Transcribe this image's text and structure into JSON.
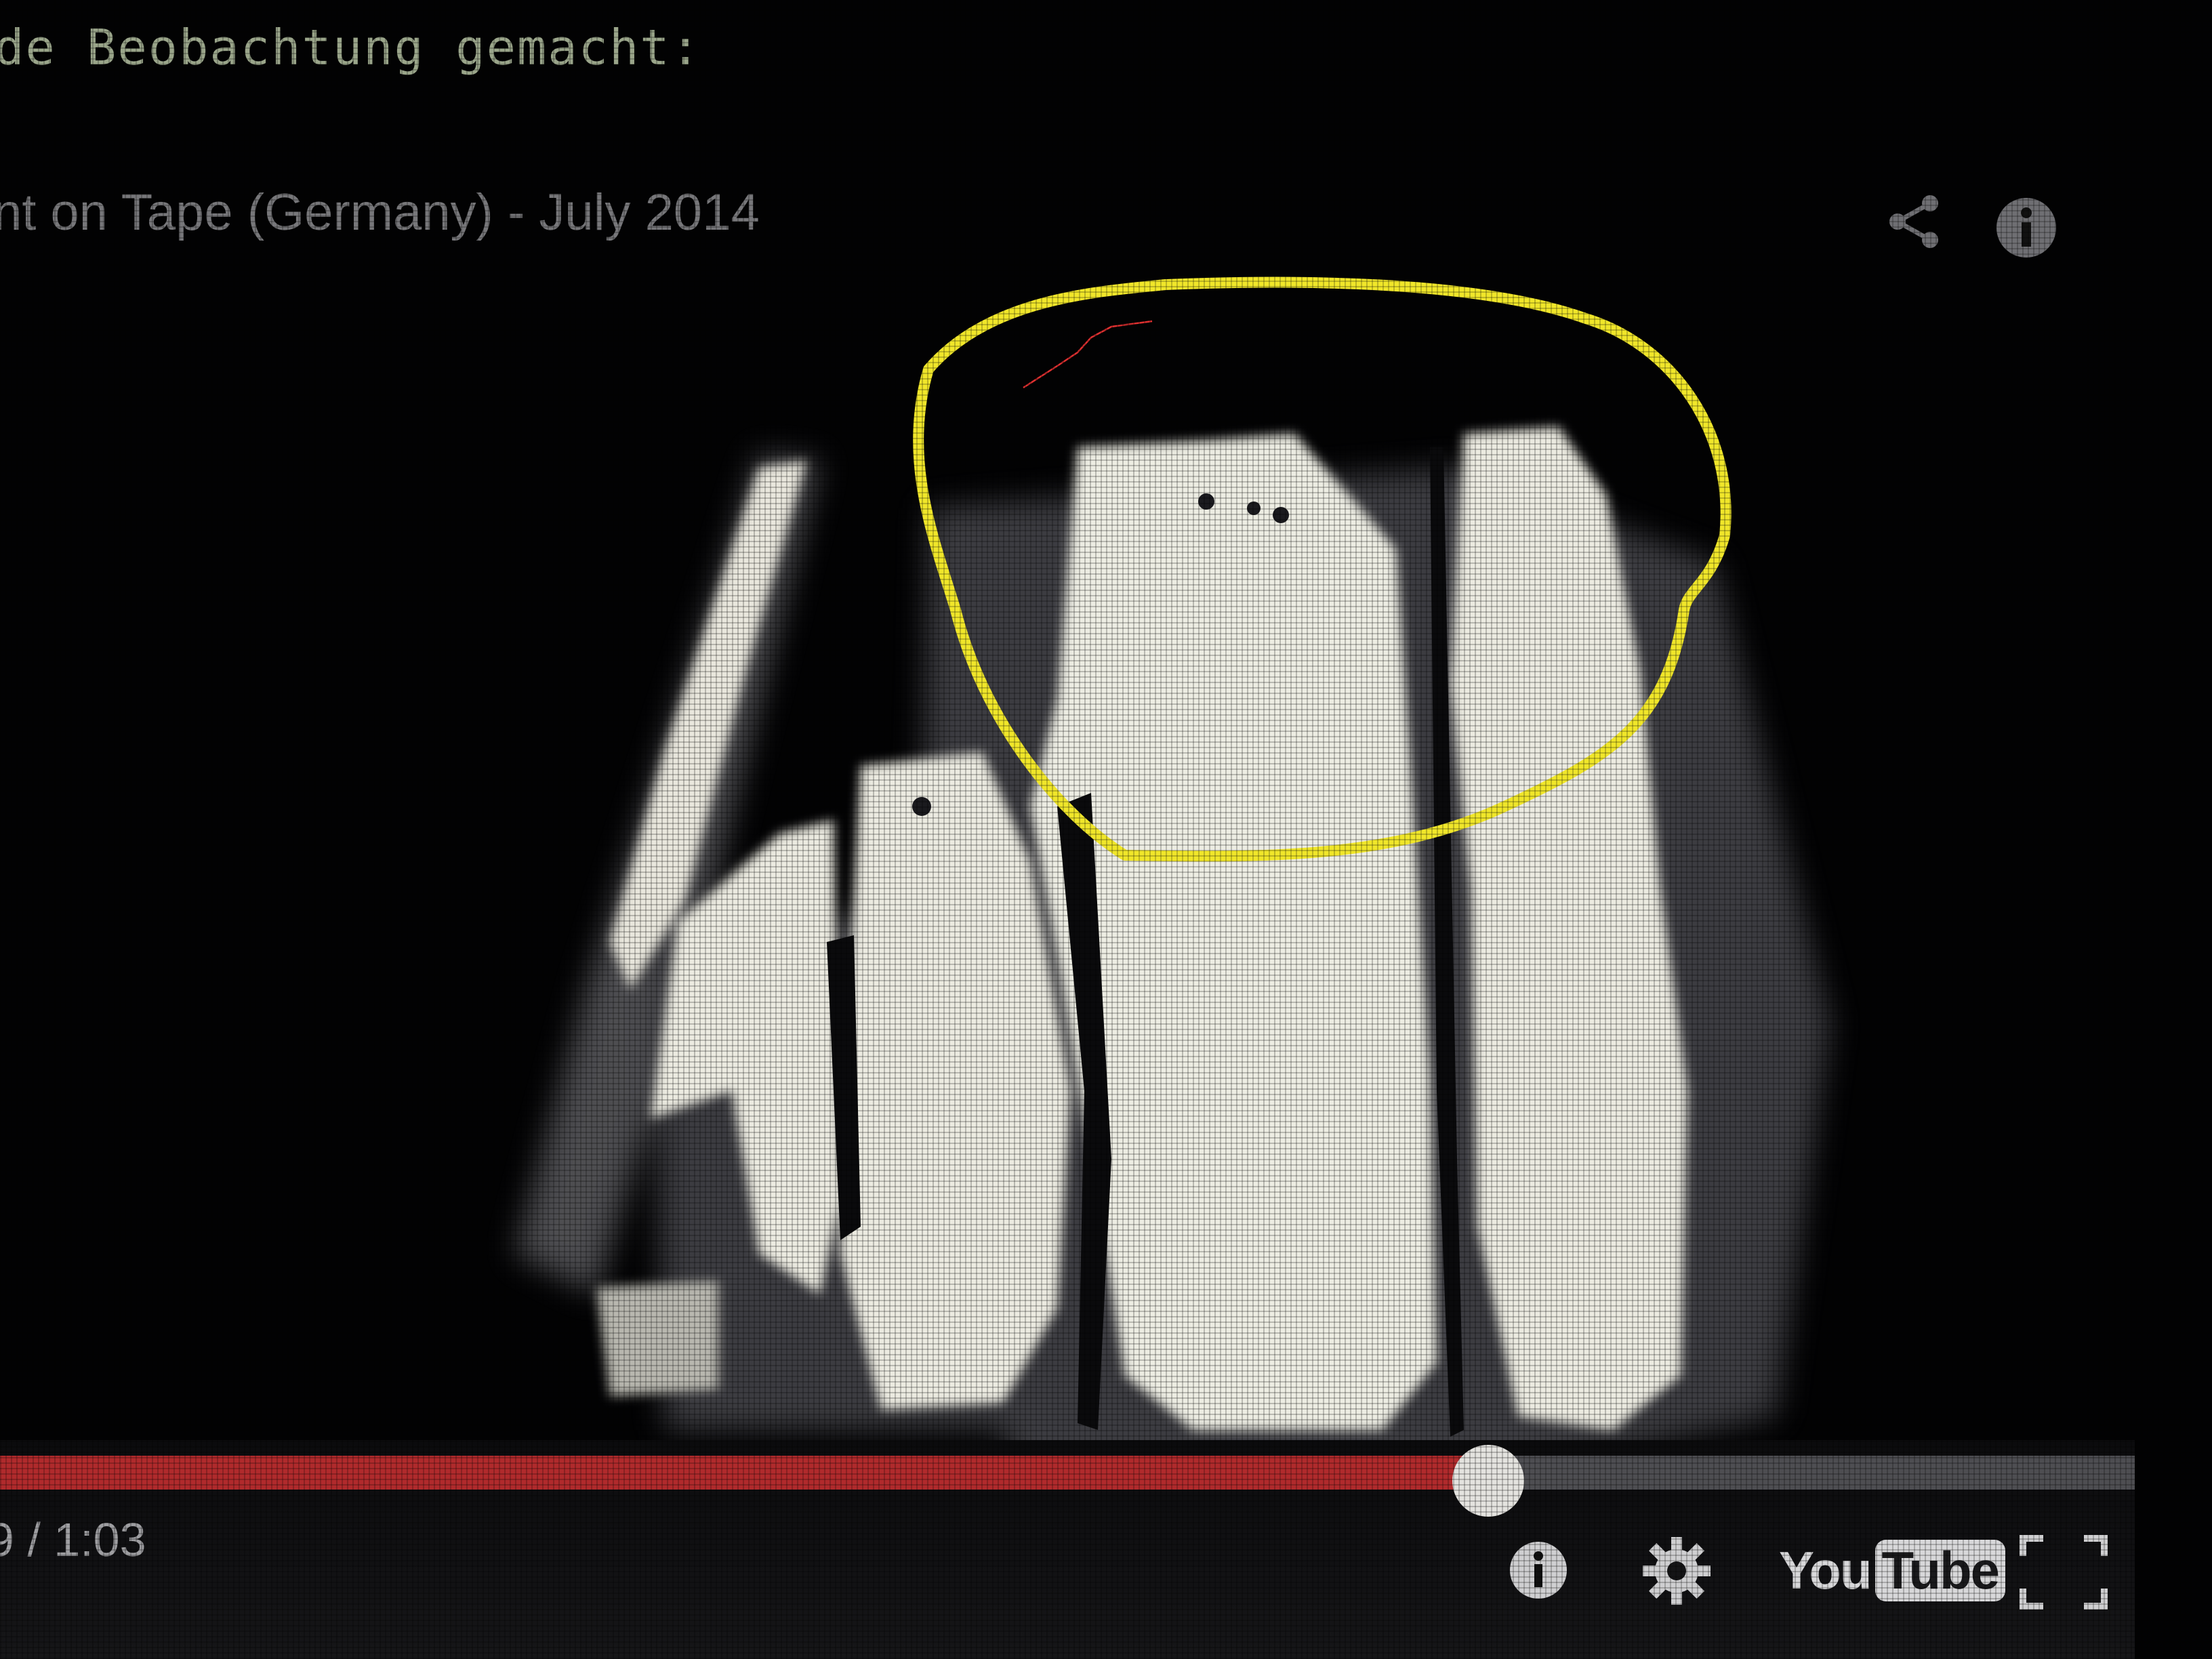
{
  "page": {
    "caption": "de Beobachtung gemacht:"
  },
  "player": {
    "title": "nt on Tape (Germany) - July 2014",
    "time_display": "9 / 1:03",
    "progress": 0.697,
    "colors": {
      "progress_played": "#b02a2c",
      "progress_track": "#4e4e52",
      "annotation": "#f0e62a"
    },
    "icons": {
      "share": "share-icon",
      "info": "info-icon",
      "annotations": "annotations-icon",
      "settings": "gear-icon",
      "fullscreen": "fullscreen-icon"
    },
    "logo": {
      "you": "You",
      "tube": "Tube"
    }
  }
}
